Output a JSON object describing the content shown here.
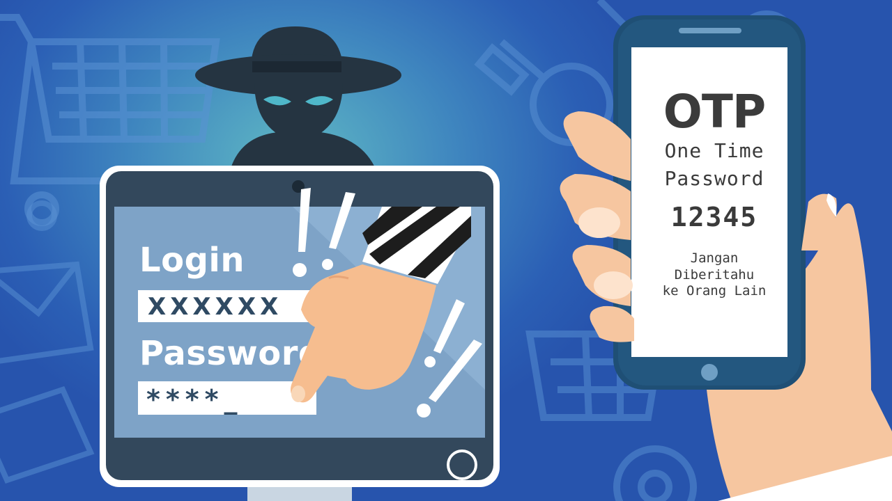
{
  "screen": {
    "login_label": "Login",
    "login_value": "XXXXXX",
    "password_label": "Password",
    "password_value": "****_"
  },
  "phone": {
    "title": "OTP",
    "subtitle_line1": "One Time",
    "subtitle_line2": "Password",
    "code": "12345",
    "warning_line1": "Jangan",
    "warning_line2": "Diberitahu",
    "warning_line3": "ke Orang Lain"
  },
  "icons": [
    "shopping-cart-icon",
    "envelope-icon",
    "magnifier-icon",
    "hacker-icon",
    "pointing-hand-icon",
    "exclamation-icon",
    "phone-hand-icon"
  ],
  "colors": {
    "background": "#2b5fb5",
    "monitor_frame": "#33485c",
    "hacker": "#253441",
    "skin": "#f6c6a0",
    "phone_body": "#1f4f75",
    "text_dark": "#3a3a3a"
  }
}
